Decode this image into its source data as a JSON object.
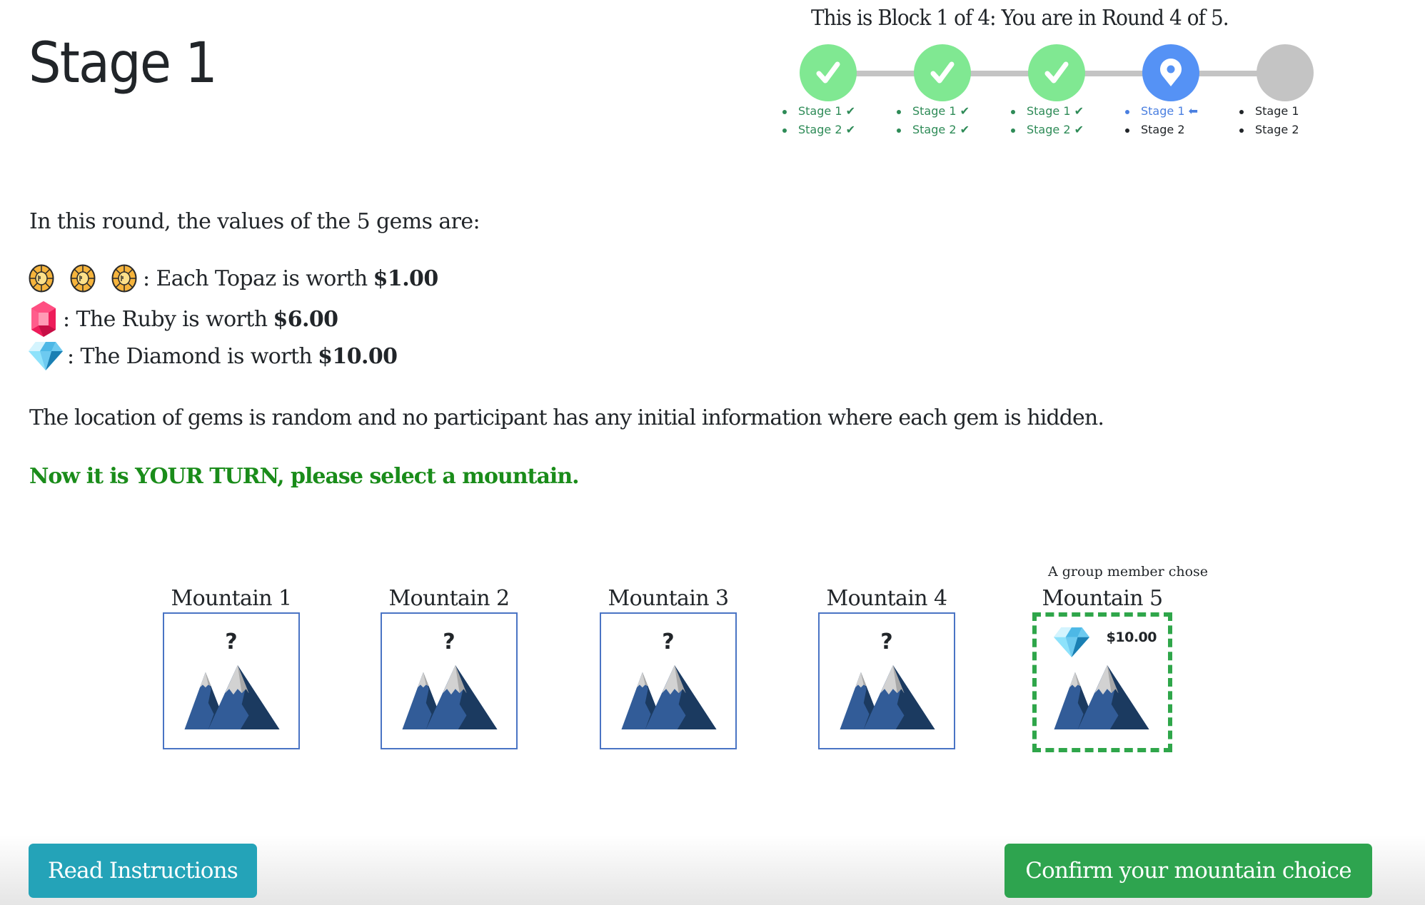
{
  "page": {
    "title": "Stage 1"
  },
  "progress": {
    "header": "This is Block 1 of 4: You are in Round 4 of 5.",
    "rounds": [
      {
        "status": "done",
        "icon": "check-icon",
        "stages": [
          "Stage 1 ✔",
          "Stage 2 ✔"
        ]
      },
      {
        "status": "done",
        "icon": "check-icon",
        "stages": [
          "Stage 1 ✔",
          "Stage 2 ✔"
        ]
      },
      {
        "status": "done",
        "icon": "check-icon",
        "stages": [
          "Stage 1 ✔",
          "Stage 2 ✔"
        ]
      },
      {
        "status": "current",
        "icon": "location-pin-icon",
        "stages": [
          "Stage 1 ⬅",
          "Stage 2"
        ]
      },
      {
        "status": "pending",
        "icon": "",
        "stages": [
          "Stage 1",
          "Stage 2"
        ]
      }
    ],
    "colors": {
      "done": "#80e892",
      "current": "#5592f5",
      "pending": "#c4c4c4",
      "track": "#c4c4c4"
    }
  },
  "gems": {
    "intro": "In this round, the values of the 5 gems are:",
    "topaz": {
      "count": 3,
      "label": ": Each Topaz is worth",
      "value": "$1.00"
    },
    "ruby": {
      "count": 1,
      "label": ": The Ruby is worth",
      "value": "$6.00"
    },
    "diamond": {
      "count": 1,
      "label": ": The Diamond is worth",
      "value": "$10.00"
    }
  },
  "note": "The location of gems is random and no participant has any initial information where each gem is hidden.",
  "turn_prompt": "Now it is YOUR TURN, please select a mountain.",
  "mountains": [
    {
      "title": "Mountain 1",
      "content": "?"
    },
    {
      "title": "Mountain 2",
      "content": "?"
    },
    {
      "title": "Mountain 3",
      "content": "?"
    },
    {
      "title": "Mountain 4",
      "content": "?"
    },
    {
      "title": "Mountain 5",
      "note": "A group member chose",
      "gem": "diamond",
      "value": "$10.00"
    }
  ],
  "buttons": {
    "read_instructions": "Read Instructions",
    "confirm": "Confirm your mountain choice"
  }
}
